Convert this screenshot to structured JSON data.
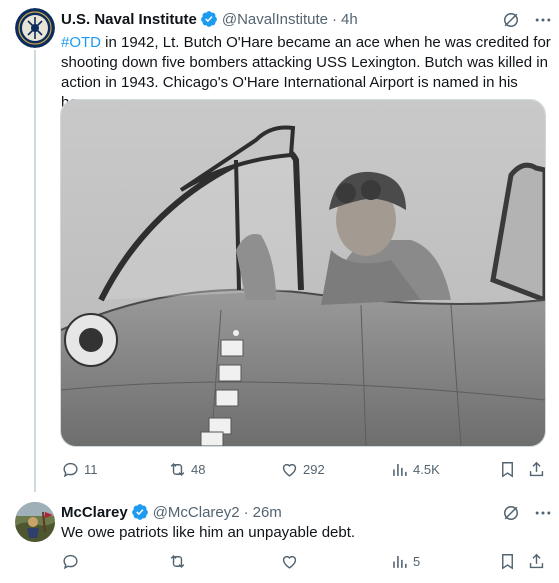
{
  "tweet1": {
    "author_name": "U.S. Naval Institute",
    "handle": "@NavalInstitute",
    "separator": "·",
    "time": "4h",
    "hashtag": "#OTD",
    "text": " in 1942, Lt. Butch O'Hare became an ace when he was credited for shooting down five bombers attacking USS Lexington. Butch was killed in action in 1943. Chicago's O'Hare International Airport is named in his honor.",
    "stats": {
      "replies": "11",
      "reposts": "48",
      "likes": "292",
      "views": "4.5K"
    }
  },
  "tweet2": {
    "author_name": "McClarey",
    "handle": "@McClarey2",
    "separator": "·",
    "time": "26m",
    "text": "We owe patriots like him an unpayable debt.",
    "stats": {
      "replies": "",
      "reposts": "",
      "likes": "",
      "views": "5"
    }
  },
  "colors": {
    "verified": "#1d9bf0",
    "hashtag": "#1d9bf0",
    "secondary_text": "#536471",
    "thread_line": "#cfd9de"
  },
  "icons": [
    "verified-badge-icon",
    "grok-icon",
    "more-icon",
    "reply-icon",
    "repost-icon",
    "like-icon",
    "views-icon",
    "bookmark-icon",
    "share-icon"
  ]
}
